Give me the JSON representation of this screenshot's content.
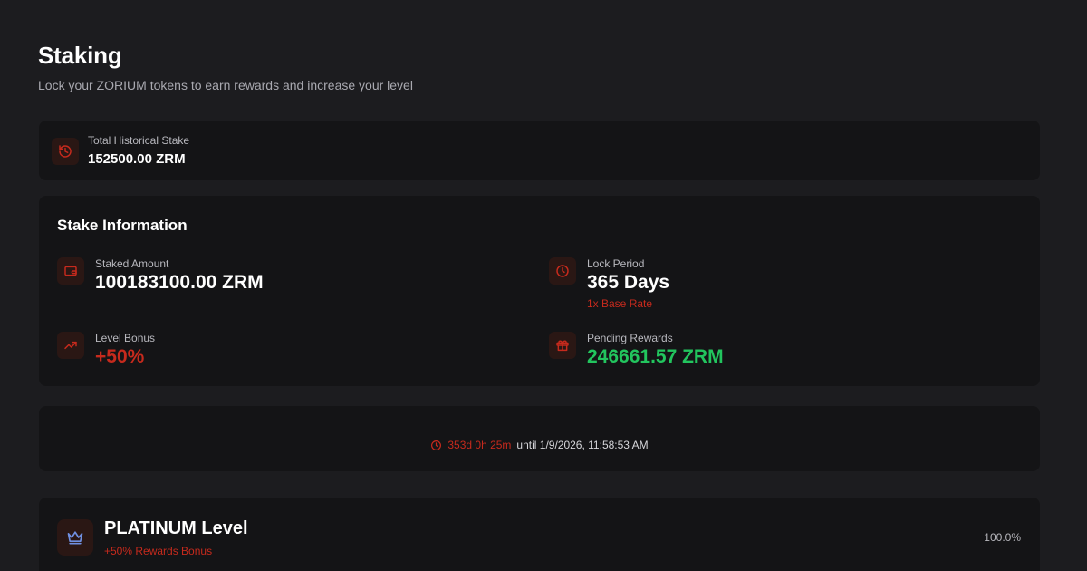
{
  "header": {
    "title": "Staking",
    "subtitle": "Lock your ZORIUM tokens to earn rewards and increase your level"
  },
  "historical": {
    "label": "Total Historical Stake",
    "value": "152500.00 ZRM",
    "icon": "history-icon"
  },
  "stake_info": {
    "title": "Stake Information",
    "staked_amount": {
      "label": "Staked Amount",
      "value": "100183100.00 ZRM",
      "icon": "wallet-icon"
    },
    "lock_period": {
      "label": "Lock Period",
      "value": "365 Days",
      "note": "1x Base Rate",
      "icon": "clock-icon"
    },
    "level_bonus": {
      "label": "Level Bonus",
      "value": "+50%",
      "icon": "trending-up-icon"
    },
    "pending_rewards": {
      "label": "Pending Rewards",
      "value": "246661.57 ZRM",
      "icon": "gift-icon"
    }
  },
  "countdown": {
    "remaining": "353d 0h 25m",
    "until": "until 1/9/2026, 11:58:53 AM",
    "icon": "clock-icon"
  },
  "level": {
    "name": "PLATINUM Level",
    "bonus": "+50% Rewards Bonus",
    "progress": "100.0%",
    "icon": "crown-icon"
  },
  "colors": {
    "background": "#1c1c1f",
    "card": "#141416",
    "accent_red": "#c62a1d",
    "accent_green": "#22c55e",
    "crown_blue": "#6f8fe0"
  }
}
